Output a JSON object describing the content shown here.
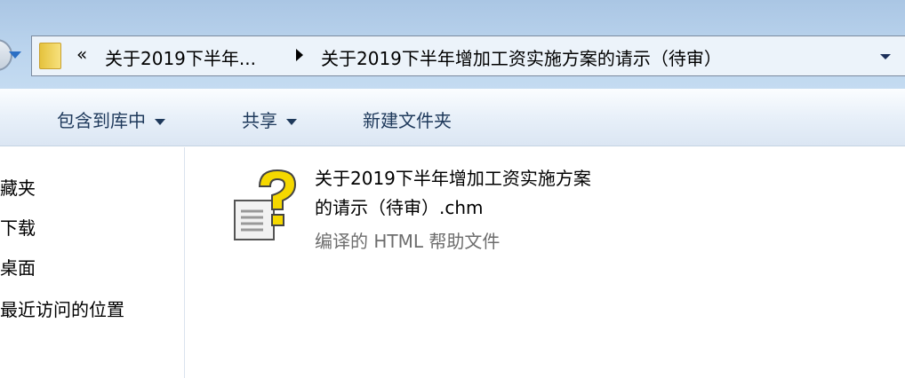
{
  "address": {
    "prefix": "«",
    "crumbs": [
      "关于2019下半年...",
      "关于2019下半年增加工资实施方案的请示（待审）"
    ]
  },
  "toolbar": {
    "include_library": "包含到库中",
    "share": "共享",
    "new_folder": "新建文件夹"
  },
  "nav": {
    "items": [
      "藏夹",
      "下载",
      "桌面",
      "最近访问的位置"
    ]
  },
  "file": {
    "name_line1": "关于2019下半年增加工资实施方案",
    "name_line2": "的请示（待审）.chm",
    "type": "编译的 HTML 帮助文件",
    "icon": "chm-help-file-icon"
  }
}
